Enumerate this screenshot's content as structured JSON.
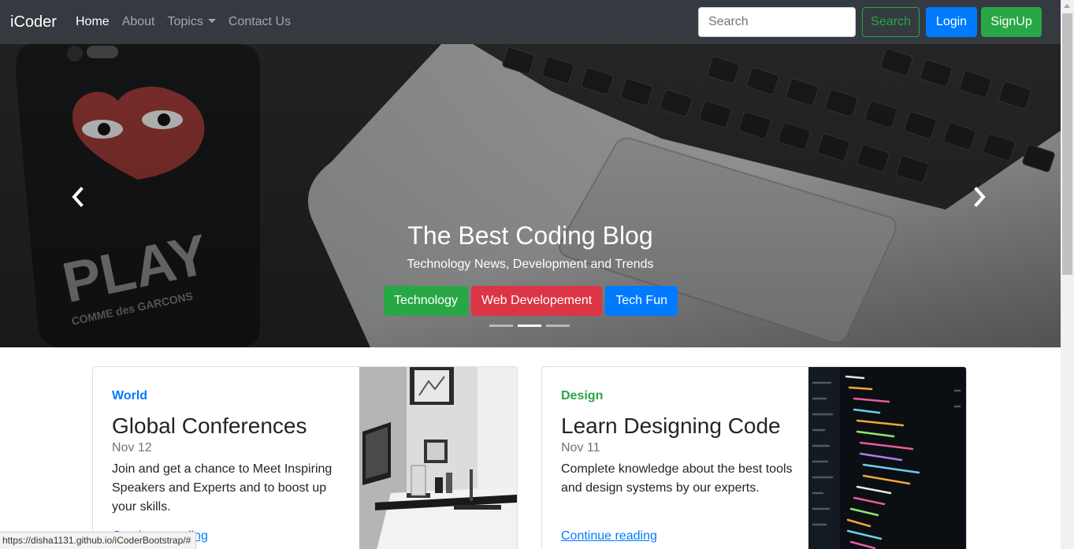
{
  "navbar": {
    "brand": "iCoder",
    "links": [
      {
        "label": "Home",
        "active": true
      },
      {
        "label": "About",
        "active": false
      },
      {
        "label": "Topics",
        "active": false,
        "dropdown": true
      },
      {
        "label": "Contact Us",
        "active": false
      }
    ],
    "search": {
      "placeholder": "Search",
      "value": ""
    },
    "search_button": "Search",
    "login_button": "Login",
    "signup_button": "SignUp"
  },
  "carousel": {
    "title": "The Best Coding Blog",
    "subtitle": "Technology News, Development and Trends",
    "buttons": [
      "Technology",
      "Web Developement",
      "Tech Fun"
    ],
    "active_slide": 1,
    "slide_count": 3
  },
  "cards": [
    {
      "category": "World",
      "title": "Global Conferences",
      "date": "Nov 12",
      "text": "Join and get a chance to Meet Inspiring Speakers and Experts and to boost up your skills.",
      "link": "Continue reading"
    },
    {
      "category": "Design",
      "title": "Learn Designing Code",
      "date": "Nov 11",
      "text": "Complete knowledge about the best tools and design systems by our experts.",
      "link": "Continue reading"
    }
  ],
  "statusbar": {
    "url": "https://disha1131.github.io/iCoderBootstrap/#"
  },
  "colors": {
    "navbar": "#343a40",
    "primary": "#007bff",
    "success": "#28a745",
    "danger": "#dc3545"
  },
  "icons": [
    "chevron-left-icon",
    "chevron-right-icon",
    "caret-down-icon"
  ]
}
